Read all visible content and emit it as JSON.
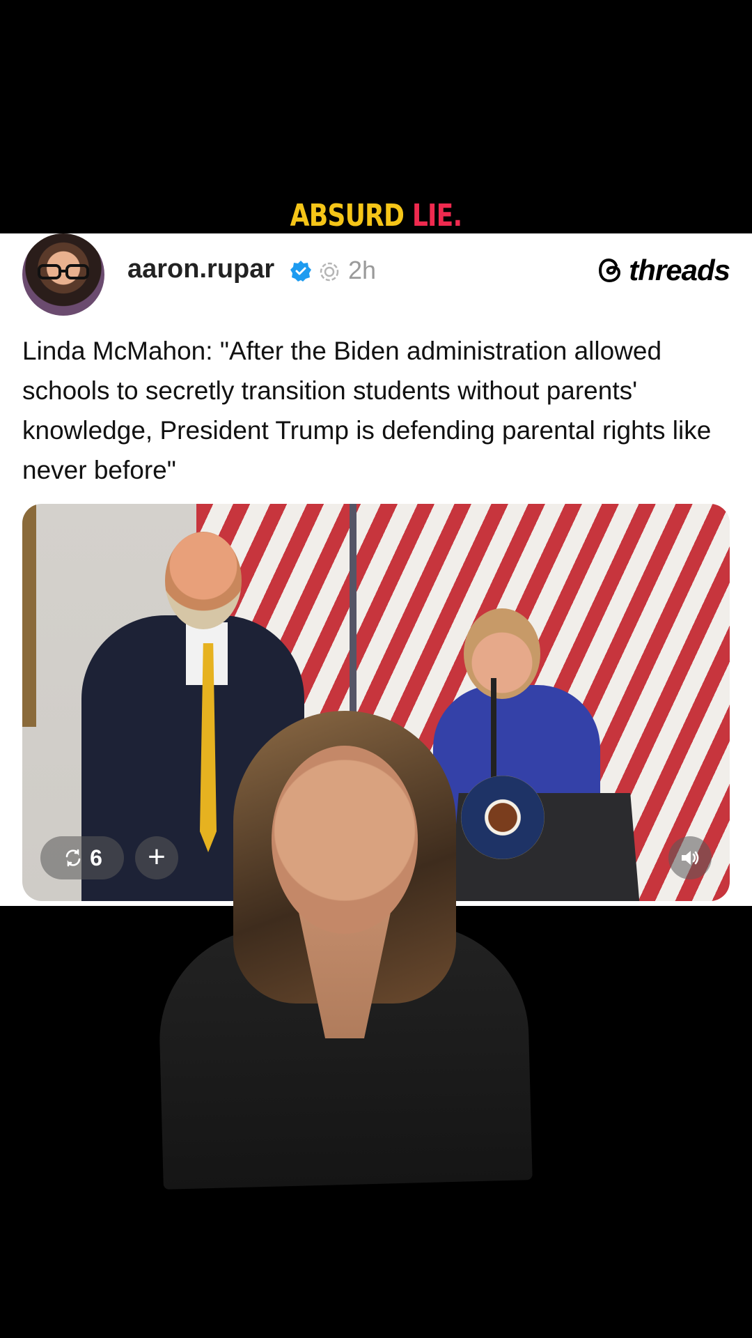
{
  "caption": {
    "word1": "ABSURD",
    "word2": "LIE."
  },
  "post": {
    "username": "aaron.rupar",
    "time": "2h",
    "logo": "threads",
    "text": "Linda McMahon: \"After the Biden administration allowed schools to secretly transition students without parents' knowledge, President Trump is defending parental rights like never before\"",
    "repost_count": "6",
    "plus": "+"
  },
  "icons": [
    "verified-badge-icon",
    "threads-circle-icon",
    "threads-logo-icon",
    "repost-icon",
    "plus-icon",
    "speaker-icon"
  ],
  "colors": {
    "caption_yellow": "#f5c518",
    "caption_red": "#ef2a4f",
    "verified_blue": "#1d9bf0"
  }
}
